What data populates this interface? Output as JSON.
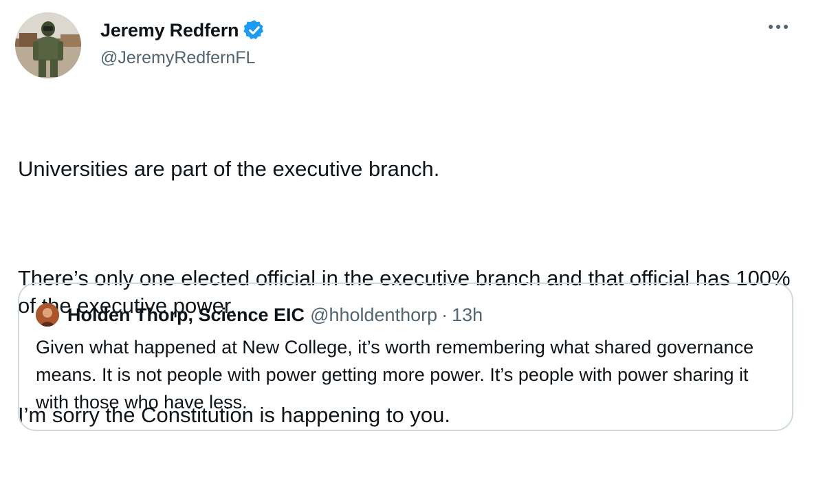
{
  "tweet": {
    "author": {
      "name": "Jeremy Redfern",
      "handle": "@JeremyRedfernFL",
      "verified": true,
      "avatar_icon": "user-avatar-photo"
    },
    "more_icon": "more-options-icon",
    "paragraphs": [
      "Universities are part of the executive branch.",
      "There’s only one elected official in the executive branch and that official has 100% of the executive power.",
      "I’m sorry the Constitution is happening to you."
    ],
    "quote": {
      "name": "Holden Thorp, Science EIC",
      "handle": "@hholdenthorp",
      "separator": "·",
      "time": "13h",
      "text": "Given what happened at New College, it’s worth remembering what shared governance means. It is not people with power getting more power. It’s people with power sharing it with those who have less."
    }
  },
  "colors": {
    "text": "#0f1419",
    "secondary": "#536471",
    "verified": "#1d9bf0",
    "border": "#cfd9de"
  }
}
